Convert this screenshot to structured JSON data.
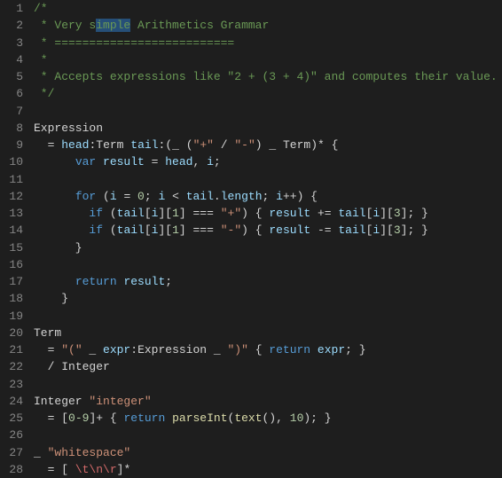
{
  "lines": [
    {
      "num": "1",
      "tokens": [
        {
          "t": "/*",
          "c": "c-comment"
        }
      ]
    },
    {
      "num": "2",
      "tokens": [
        {
          "t": " * Very s",
          "c": "c-comment"
        },
        {
          "t": "i",
          "c": "c-comment sel"
        },
        {
          "t": "mple",
          "c": "c-comment sel",
          "selEnd": true
        },
        {
          "t": " Arithmetics Grammar",
          "c": "c-comment"
        }
      ]
    },
    {
      "num": "3",
      "tokens": [
        {
          "t": " * ==========================",
          "c": "c-comment"
        }
      ]
    },
    {
      "num": "4",
      "tokens": [
        {
          "t": " *",
          "c": "c-comment"
        }
      ]
    },
    {
      "num": "5",
      "tokens": [
        {
          "t": " * Accepts expressions like \"2 + (3 + 4)\" and computes their value.",
          "c": "c-comment"
        }
      ]
    },
    {
      "num": "6",
      "tokens": [
        {
          "t": " */",
          "c": "c-comment"
        }
      ]
    },
    {
      "num": "7",
      "tokens": []
    },
    {
      "num": "8",
      "tokens": [
        {
          "t": "Expression",
          "c": "c-ident"
        }
      ]
    },
    {
      "num": "9",
      "tokens": [
        {
          "t": "  ",
          "c": ""
        },
        {
          "t": "=",
          "c": "c-op"
        },
        {
          "t": " ",
          "c": ""
        },
        {
          "t": "head",
          "c": "c-var"
        },
        {
          "t": ":",
          "c": "c-punct"
        },
        {
          "t": "Term",
          "c": "c-ident"
        },
        {
          "t": " ",
          "c": ""
        },
        {
          "t": "tail",
          "c": "c-var"
        },
        {
          "t": ":",
          "c": "c-punct"
        },
        {
          "t": "(",
          "c": "c-paren"
        },
        {
          "t": "_ ",
          "c": "c-ident"
        },
        {
          "t": "(",
          "c": "c-paren"
        },
        {
          "t": "\"+\"",
          "c": "c-string"
        },
        {
          "t": " / ",
          "c": "c-op"
        },
        {
          "t": "\"-\"",
          "c": "c-string"
        },
        {
          "t": ")",
          "c": "c-paren"
        },
        {
          "t": " _ Term",
          "c": "c-ident"
        },
        {
          "t": ")",
          "c": "c-paren"
        },
        {
          "t": "*",
          "c": "c-op"
        },
        {
          "t": " {",
          "c": "c-punct"
        }
      ]
    },
    {
      "num": "10",
      "tokens": [
        {
          "t": "      ",
          "c": ""
        },
        {
          "t": "var",
          "c": "c-keyword"
        },
        {
          "t": " ",
          "c": ""
        },
        {
          "t": "result",
          "c": "c-var"
        },
        {
          "t": " = ",
          "c": "c-op"
        },
        {
          "t": "head",
          "c": "c-var"
        },
        {
          "t": ", ",
          "c": "c-punct"
        },
        {
          "t": "i",
          "c": "c-var"
        },
        {
          "t": ";",
          "c": "c-punct"
        }
      ]
    },
    {
      "num": "11",
      "tokens": []
    },
    {
      "num": "12",
      "tokens": [
        {
          "t": "      ",
          "c": ""
        },
        {
          "t": "for",
          "c": "c-keyword"
        },
        {
          "t": " (",
          "c": "c-punct"
        },
        {
          "t": "i",
          "c": "c-var"
        },
        {
          "t": " = ",
          "c": "c-op"
        },
        {
          "t": "0",
          "c": "c-number"
        },
        {
          "t": "; ",
          "c": "c-punct"
        },
        {
          "t": "i",
          "c": "c-var"
        },
        {
          "t": " < ",
          "c": "c-op"
        },
        {
          "t": "tail",
          "c": "c-var"
        },
        {
          "t": ".",
          "c": "c-punct"
        },
        {
          "t": "length",
          "c": "c-var"
        },
        {
          "t": "; ",
          "c": "c-punct"
        },
        {
          "t": "i",
          "c": "c-var"
        },
        {
          "t": "++",
          "c": "c-op"
        },
        {
          "t": ") {",
          "c": "c-punct"
        }
      ]
    },
    {
      "num": "13",
      "tokens": [
        {
          "t": "        ",
          "c": ""
        },
        {
          "t": "if",
          "c": "c-keyword"
        },
        {
          "t": " (",
          "c": "c-punct"
        },
        {
          "t": "tail",
          "c": "c-var"
        },
        {
          "t": "[",
          "c": "c-punct"
        },
        {
          "t": "i",
          "c": "c-var"
        },
        {
          "t": "][",
          "c": "c-punct"
        },
        {
          "t": "1",
          "c": "c-number"
        },
        {
          "t": "] === ",
          "c": "c-op"
        },
        {
          "t": "\"+\"",
          "c": "c-string"
        },
        {
          "t": ") { ",
          "c": "c-punct"
        },
        {
          "t": "result",
          "c": "c-var"
        },
        {
          "t": " += ",
          "c": "c-op"
        },
        {
          "t": "tail",
          "c": "c-var"
        },
        {
          "t": "[",
          "c": "c-punct"
        },
        {
          "t": "i",
          "c": "c-var"
        },
        {
          "t": "][",
          "c": "c-punct"
        },
        {
          "t": "3",
          "c": "c-number"
        },
        {
          "t": "]; }",
          "c": "c-punct"
        }
      ]
    },
    {
      "num": "14",
      "tokens": [
        {
          "t": "        ",
          "c": ""
        },
        {
          "t": "if",
          "c": "c-keyword"
        },
        {
          "t": " (",
          "c": "c-punct"
        },
        {
          "t": "tail",
          "c": "c-var"
        },
        {
          "t": "[",
          "c": "c-punct"
        },
        {
          "t": "i",
          "c": "c-var"
        },
        {
          "t": "][",
          "c": "c-punct"
        },
        {
          "t": "1",
          "c": "c-number"
        },
        {
          "t": "] === ",
          "c": "c-op"
        },
        {
          "t": "\"-\"",
          "c": "c-string"
        },
        {
          "t": ") { ",
          "c": "c-punct"
        },
        {
          "t": "result",
          "c": "c-var"
        },
        {
          "t": " -= ",
          "c": "c-op"
        },
        {
          "t": "tail",
          "c": "c-var"
        },
        {
          "t": "[",
          "c": "c-punct"
        },
        {
          "t": "i",
          "c": "c-var"
        },
        {
          "t": "][",
          "c": "c-punct"
        },
        {
          "t": "3",
          "c": "c-number"
        },
        {
          "t": "]; }",
          "c": "c-punct"
        }
      ]
    },
    {
      "num": "15",
      "tokens": [
        {
          "t": "      }",
          "c": "c-punct"
        }
      ]
    },
    {
      "num": "16",
      "tokens": []
    },
    {
      "num": "17",
      "tokens": [
        {
          "t": "      ",
          "c": ""
        },
        {
          "t": "return",
          "c": "c-keyword"
        },
        {
          "t": " ",
          "c": ""
        },
        {
          "t": "result",
          "c": "c-var"
        },
        {
          "t": ";",
          "c": "c-punct"
        }
      ]
    },
    {
      "num": "18",
      "tokens": [
        {
          "t": "    }",
          "c": "c-punct"
        }
      ]
    },
    {
      "num": "19",
      "tokens": []
    },
    {
      "num": "20",
      "tokens": [
        {
          "t": "Term",
          "c": "c-ident"
        }
      ]
    },
    {
      "num": "21",
      "tokens": [
        {
          "t": "  = ",
          "c": "c-op"
        },
        {
          "t": "\"(\"",
          "c": "c-string"
        },
        {
          "t": " _ ",
          "c": "c-ident"
        },
        {
          "t": "expr",
          "c": "c-var"
        },
        {
          "t": ":",
          "c": "c-punct"
        },
        {
          "t": "Expression",
          "c": "c-ident"
        },
        {
          "t": " _ ",
          "c": "c-ident"
        },
        {
          "t": "\")\"",
          "c": "c-string"
        },
        {
          "t": " { ",
          "c": "c-punct"
        },
        {
          "t": "return",
          "c": "c-keyword"
        },
        {
          "t": " ",
          "c": ""
        },
        {
          "t": "expr",
          "c": "c-var"
        },
        {
          "t": "; }",
          "c": "c-punct"
        }
      ]
    },
    {
      "num": "22",
      "tokens": [
        {
          "t": "  / ",
          "c": "c-op"
        },
        {
          "t": "Integer",
          "c": "c-ident"
        }
      ]
    },
    {
      "num": "23",
      "tokens": []
    },
    {
      "num": "24",
      "tokens": [
        {
          "t": "Integer",
          "c": "c-ident"
        },
        {
          "t": " ",
          "c": ""
        },
        {
          "t": "\"integer\"",
          "c": "c-string"
        }
      ]
    },
    {
      "num": "25",
      "tokens": [
        {
          "t": "  = ",
          "c": "c-op"
        },
        {
          "t": "[",
          "c": "c-punct"
        },
        {
          "t": "0-9",
          "c": "c-const"
        },
        {
          "t": "]",
          "c": "c-punct"
        },
        {
          "t": "+",
          "c": "c-op"
        },
        {
          "t": " { ",
          "c": "c-punct"
        },
        {
          "t": "return",
          "c": "c-keyword"
        },
        {
          "t": " ",
          "c": ""
        },
        {
          "t": "parseInt",
          "c": "c-func"
        },
        {
          "t": "(",
          "c": "c-punct"
        },
        {
          "t": "text",
          "c": "c-func"
        },
        {
          "t": "(), ",
          "c": "c-punct"
        },
        {
          "t": "10",
          "c": "c-number"
        },
        {
          "t": "); }",
          "c": "c-punct"
        }
      ]
    },
    {
      "num": "26",
      "tokens": []
    },
    {
      "num": "27",
      "tokens": [
        {
          "t": "_ ",
          "c": "c-ident"
        },
        {
          "t": "\"whitespace\"",
          "c": "c-string"
        }
      ]
    },
    {
      "num": "28",
      "tokens": [
        {
          "t": "  = ",
          "c": "c-op"
        },
        {
          "t": "[ ",
          "c": "c-punct"
        },
        {
          "t": "\\t\\n\\r",
          "c": "c-regex"
        },
        {
          "t": "]",
          "c": "c-punct"
        },
        {
          "t": "*",
          "c": "c-op"
        }
      ]
    }
  ]
}
